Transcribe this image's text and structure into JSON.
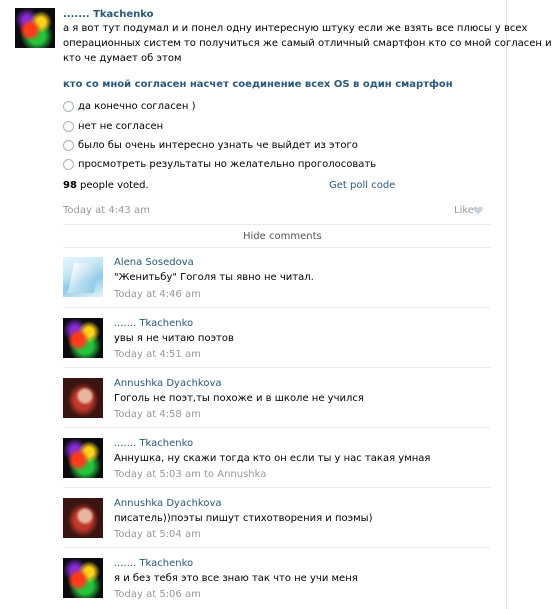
{
  "post": {
    "author": "....... Tkachenko",
    "text_lines": [
      "а я вот тут подумал и и понел одну интересную штуку если же взять все плюсы у всех",
      "операционных систем то получиться же самый отличный смартфон кто со мной согласен и",
      "кто че думает об этом"
    ],
    "time": "Today at 4:43 am",
    "like_label": "Like"
  },
  "poll": {
    "question": "кто со мной согласен насчет соединение всех OS в один смартфон",
    "options": [
      "да конечно согласен )",
      "нет не согласен",
      "было бы очень интересно узнать че выйдет из этого",
      "просмотреть результаты но желательно проголосовать"
    ],
    "votes_count": "98",
    "votes_label": "people voted.",
    "get_code_label": "Get poll code"
  },
  "hide_comments_label": "Hide comments",
  "comments": [
    {
      "author": "Alena Sosedova",
      "text": "\"Женитьбу\" Гоголя ты явно не читал.",
      "time": "Today at 4:46 am"
    },
    {
      "author": "....... Tkachenko",
      "text": "увы я не читаю поэтов",
      "time": "Today at 4:51 am"
    },
    {
      "author": "Annushka Dyachkova",
      "text": "Гоголь не поэт,ты похоже и в школе не учился",
      "time": "Today at 4:58 am"
    },
    {
      "author": "....... Tkachenko",
      "text": "Аннушка, ну скажи тогда кто он если ты у нас такая умная",
      "time": "Today at 5:03 am to Annushka"
    },
    {
      "author": "Annushka Dyachkova",
      "text": "писатель))поэты пишут стихотворения и поэмы)",
      "time": "Today at 5:04 am"
    },
    {
      "author": "....... Tkachenko",
      "text": "я и без тебя это все знаю так что не учи меня",
      "time": "Today at 5:06 am"
    }
  ],
  "colors": {
    "link": "#2b587a",
    "meta": "#999999",
    "separator": "#e7eaed"
  },
  "icons": {
    "like": "heart-icon",
    "radio": "radio-icon"
  }
}
